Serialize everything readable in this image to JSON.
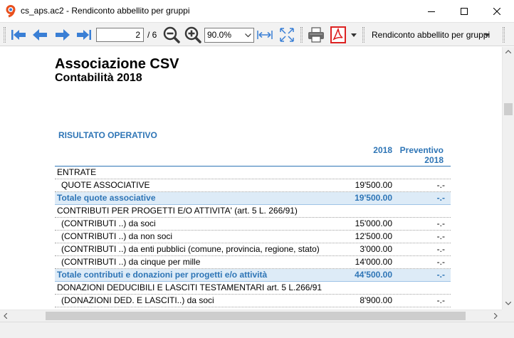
{
  "window": {
    "title": "cs_aps.ac2 - Rendiconto abbellito per gruppi"
  },
  "toolbar": {
    "page_current": "2",
    "page_total": "/ 6",
    "zoom": "90.0%",
    "report_selector": "Rendiconto abbellito per gruppi"
  },
  "icons": {
    "app": "app-logo-icon",
    "first": "first-page-icon",
    "prev": "previous-page-icon",
    "next": "next-page-icon",
    "last": "last-page-icon",
    "zoom_out": "zoom-out-icon",
    "zoom_in": "zoom-in-icon",
    "fit_width": "fit-width-icon",
    "fit_page": "fit-page-icon",
    "print": "printer-icon",
    "pdf": "pdf-icon"
  },
  "colors": {
    "accent": "#2e75b6",
    "total_row_bg": "#ddebf7"
  },
  "document": {
    "title": "Associazione CSV",
    "subtitle": "Contabilità 2018",
    "section": "RISULTATO OPERATIVO",
    "col_year": "2018",
    "col_budget": "Preventivo 2018",
    "rows": [
      {
        "label": "ENTRATE",
        "v1": "",
        "v2": "",
        "type": "group"
      },
      {
        "label": "QUOTE ASSOCIATIVE",
        "v1": "19'500.00",
        "v2": "-.-",
        "type": "indent"
      },
      {
        "label": "Totale quote associative",
        "v1": "19'500.00",
        "v2": "-.-",
        "type": "total"
      },
      {
        "label": "CONTRIBUTI PER PROGETTI E/O ATTIVITA'  (art. 5 L. 266/91)",
        "v1": "",
        "v2": "",
        "type": "group"
      },
      {
        "label": "(CONTRIBUTI ..) da soci",
        "v1": "15'000.00",
        "v2": "-.-",
        "type": "indent"
      },
      {
        "label": "(CONTRIBUTI ..) da non soci",
        "v1": "12'500.00",
        "v2": "-.-",
        "type": "indent"
      },
      {
        "label": "(CONTRIBUTI ..)  da enti pubblici (comune, provincia, regione, stato)",
        "v1": "3'000.00",
        "v2": "-.-",
        "type": "indent"
      },
      {
        "label": "(CONTRIBUTI ..) da cinque per mille",
        "v1": "14'000.00",
        "v2": "-.-",
        "type": "indent"
      },
      {
        "label": "Totale contributi e donazioni per progetti e/o attività",
        "v1": "44'500.00",
        "v2": "-.-",
        "type": "total"
      },
      {
        "label": "DONAZIONI DEDUCIBILI E LASCITI TESTAMENTARI art. 5 L.266/91",
        "v1": "",
        "v2": "",
        "type": "group"
      },
      {
        "label": "(DONAZIONI DED. E LASCITI..) da soci",
        "v1": "8'900.00",
        "v2": "-.-",
        "type": "indent"
      }
    ]
  }
}
